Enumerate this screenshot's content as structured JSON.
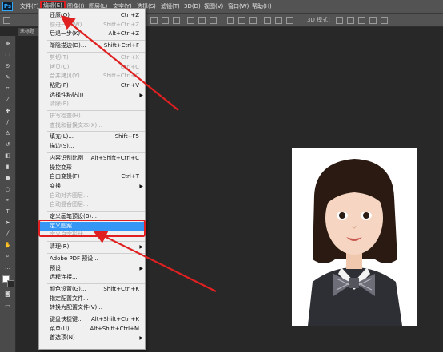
{
  "app": {
    "logo": "Ps"
  },
  "menubar": {
    "file": "文件(F)",
    "edit": "编辑(E)",
    "image": "图像(I)",
    "layer": "图层(L)",
    "type": "文字(Y)",
    "select": "选择(S)",
    "filter": "滤镜(T)",
    "three_d": "3D(D)",
    "view": "视图(V)",
    "window": "窗口(W)",
    "help": "帮助(H)"
  },
  "options": {
    "three_d_mode": "3D 模式："
  },
  "document": {
    "tab_label": "未标题"
  },
  "edit_menu": [
    {
      "label": "还原(O)",
      "shortcut": "Ctrl+Z",
      "state": "normal"
    },
    {
      "label": "前进一步(W)",
      "shortcut": "Shift+Ctrl+Z",
      "state": "disabled"
    },
    {
      "label": "后退一步(K)",
      "shortcut": "Alt+Ctrl+Z",
      "state": "normal"
    },
    {
      "sep": true
    },
    {
      "label": "渐隐描边(D)...",
      "shortcut": "Shift+Ctrl+F",
      "state": "normal"
    },
    {
      "sep": true
    },
    {
      "label": "剪切(T)",
      "shortcut": "Ctrl+X",
      "state": "disabled"
    },
    {
      "label": "拷贝(C)",
      "shortcut": "Ctrl+C",
      "state": "disabled"
    },
    {
      "label": "合并拷贝(Y)",
      "shortcut": "Shift+Ctrl+C",
      "state": "disabled"
    },
    {
      "label": "粘贴(P)",
      "shortcut": "Ctrl+V",
      "state": "normal"
    },
    {
      "label": "选择性粘贴(I)",
      "shortcut": "",
      "state": "normal",
      "submenu": true
    },
    {
      "label": "清除(E)",
      "shortcut": "",
      "state": "disabled"
    },
    {
      "sep": true
    },
    {
      "label": "拼写检查(H)...",
      "shortcut": "",
      "state": "disabled"
    },
    {
      "label": "查找和替换文本(X)...",
      "shortcut": "",
      "state": "disabled"
    },
    {
      "sep": true
    },
    {
      "label": "填充(L)...",
      "shortcut": "Shift+F5",
      "state": "normal"
    },
    {
      "label": "描边(S)...",
      "shortcut": "",
      "state": "normal"
    },
    {
      "sep": true
    },
    {
      "label": "内容识别比例",
      "shortcut": "Alt+Shift+Ctrl+C",
      "state": "normal"
    },
    {
      "label": "操控变形",
      "shortcut": "",
      "state": "normal"
    },
    {
      "label": "自由变换(F)",
      "shortcut": "Ctrl+T",
      "state": "normal"
    },
    {
      "label": "变换",
      "shortcut": "",
      "state": "normal",
      "submenu": true
    },
    {
      "label": "自动对齐图层...",
      "shortcut": "",
      "state": "disabled"
    },
    {
      "label": "自动混合图层...",
      "shortcut": "",
      "state": "disabled"
    },
    {
      "sep": true
    },
    {
      "label": "定义画笔预设(B)...",
      "shortcut": "",
      "state": "normal"
    },
    {
      "label": "定义图案...",
      "shortcut": "",
      "state": "highlighted"
    },
    {
      "label": "定义自定形状...",
      "shortcut": "",
      "state": "disabled"
    },
    {
      "sep": true
    },
    {
      "label": "清理(R)",
      "shortcut": "",
      "state": "normal",
      "submenu": true
    },
    {
      "sep": true
    },
    {
      "label": "Adobe PDF 预设...",
      "shortcut": "",
      "state": "normal"
    },
    {
      "label": "预设",
      "shortcut": "",
      "state": "normal",
      "submenu": true
    },
    {
      "label": "远程连接...",
      "shortcut": "",
      "state": "normal"
    },
    {
      "sep": true
    },
    {
      "label": "颜色设置(G)...",
      "shortcut": "Shift+Ctrl+K",
      "state": "normal"
    },
    {
      "label": "指定配置文件...",
      "shortcut": "",
      "state": "normal"
    },
    {
      "label": "转换为配置文件(V)...",
      "shortcut": "",
      "state": "normal"
    },
    {
      "sep": true
    },
    {
      "label": "键盘快捷键...",
      "shortcut": "Alt+Shift+Ctrl+K",
      "state": "normal"
    },
    {
      "label": "菜单(U)...",
      "shortcut": "Alt+Shift+Ctrl+M",
      "state": "normal"
    },
    {
      "label": "首选项(N)",
      "shortcut": "",
      "state": "normal",
      "submenu": true
    }
  ],
  "colors": {
    "highlight": "#3596f5",
    "annotation": "#e02020",
    "ps_blue": "#31a8ff"
  }
}
